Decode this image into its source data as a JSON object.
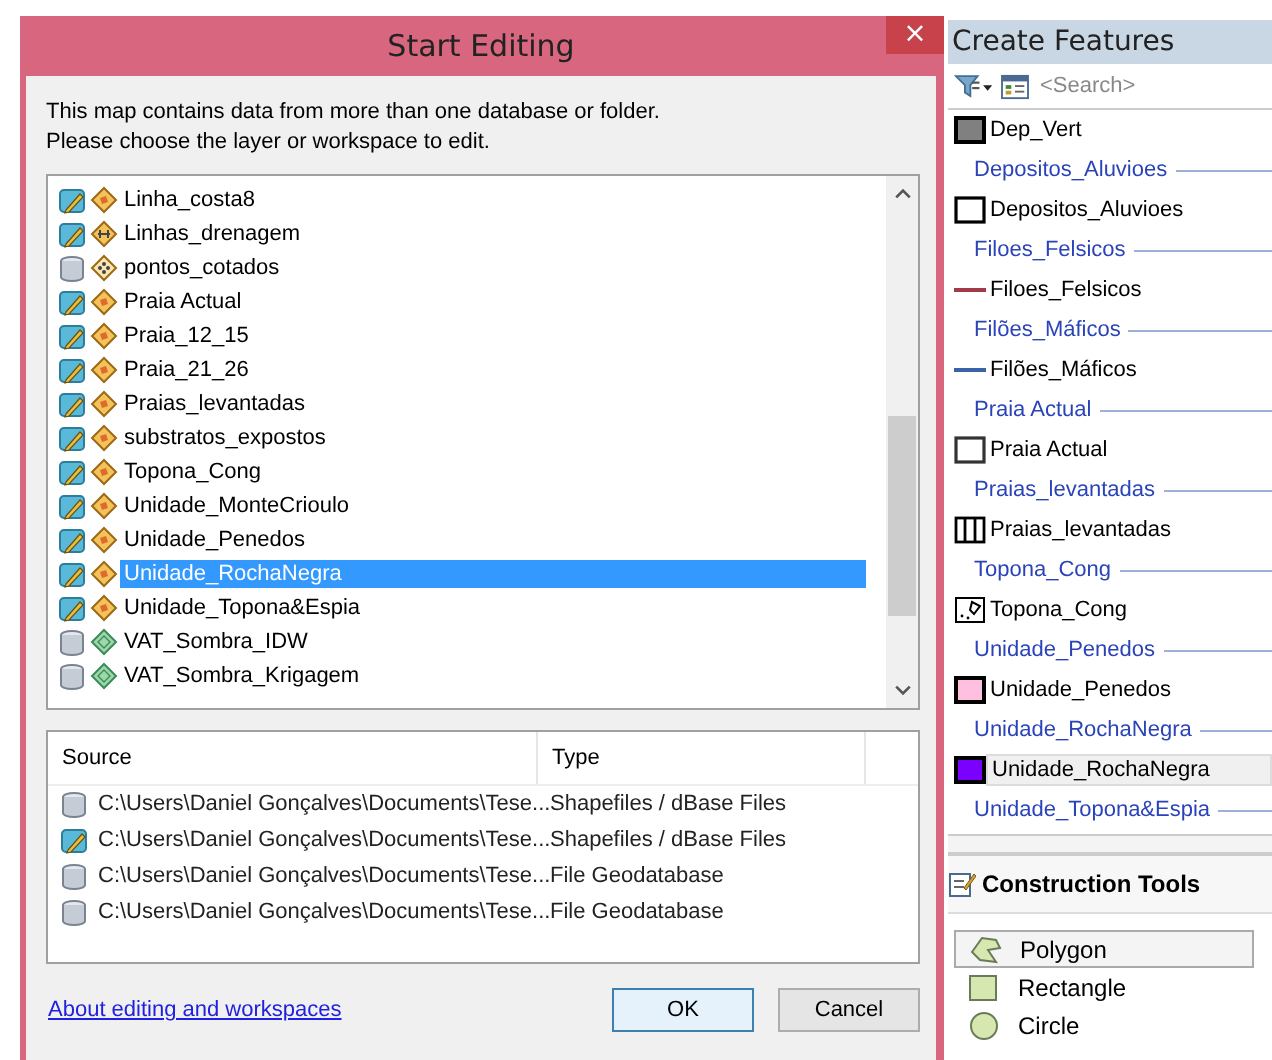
{
  "dialog": {
    "title": "Start Editing",
    "close": "×",
    "message": [
      "This map contains data from more than one database or folder.",
      "Please choose the layer or workspace to edit."
    ],
    "layers": [
      {
        "name": "Linha_costa8",
        "editable": true,
        "kind": "polygon",
        "selected": false
      },
      {
        "name": "Linhas_drenagem",
        "editable": true,
        "kind": "line",
        "selected": false
      },
      {
        "name": "pontos_cotados",
        "editable": false,
        "kind": "point",
        "selected": false
      },
      {
        "name": "Praia Actual",
        "editable": true,
        "kind": "polygon",
        "selected": false
      },
      {
        "name": "Praia_12_15",
        "editable": true,
        "kind": "polygon",
        "selected": false
      },
      {
        "name": "Praia_21_26",
        "editable": true,
        "kind": "polygon",
        "selected": false
      },
      {
        "name": "Praias_levantadas",
        "editable": true,
        "kind": "polygon",
        "selected": false
      },
      {
        "name": "substratos_expostos",
        "editable": true,
        "kind": "polygon",
        "selected": false
      },
      {
        "name": "Topona_Cong",
        "editable": true,
        "kind": "polygon",
        "selected": false
      },
      {
        "name": "Unidade_MonteCrioulo",
        "editable": true,
        "kind": "polygon",
        "selected": false
      },
      {
        "name": "Unidade_Penedos",
        "editable": true,
        "kind": "polygon",
        "selected": false
      },
      {
        "name": "Unidade_RochaNegra",
        "editable": true,
        "kind": "polygon",
        "selected": true
      },
      {
        "name": "Unidade_Topona&Espia",
        "editable": true,
        "kind": "polygon",
        "selected": false
      },
      {
        "name": "VAT_Sombra_IDW",
        "editable": false,
        "kind": "raster",
        "selected": false
      },
      {
        "name": "VAT_Sombra_Krigagem",
        "editable": false,
        "kind": "raster",
        "selected": false
      }
    ],
    "sources": {
      "columns": [
        "Source",
        "Type"
      ],
      "rows": [
        {
          "source": "C:\\Users\\Daniel Gonçalves\\Documents\\Tese...",
          "type": "Shapefiles / dBase Files",
          "editable": false
        },
        {
          "source": "C:\\Users\\Daniel Gonçalves\\Documents\\Tese...",
          "type": "Shapefiles / dBase Files",
          "editable": true
        },
        {
          "source": "C:\\Users\\Daniel Gonçalves\\Documents\\Tese...",
          "type": "File Geodatabase",
          "editable": false
        },
        {
          "source": "C:\\Users\\Daniel Gonçalves\\Documents\\Tese...",
          "type": "File Geodatabase",
          "editable": false
        }
      ]
    },
    "link": "About editing and workspaces",
    "buttons": [
      {
        "label": "OK",
        "default": true
      },
      {
        "label": "Cancel",
        "default": false
      }
    ]
  },
  "panel": {
    "title": "Create Features",
    "search": {
      "placeholder": "<Search>"
    },
    "templates": [
      {
        "kind": "fill",
        "name": "Dep_Vert",
        "color": "#808080",
        "selected": false
      },
      {
        "kind": "group",
        "name": "Depositos_Aluvioes"
      },
      {
        "kind": "outline",
        "name": "Depositos_Aluvioes",
        "color": "#000000",
        "selected": false
      },
      {
        "kind": "group",
        "name": "Filoes_Felsicos"
      },
      {
        "kind": "line",
        "name": "Filoes_Felsicos",
        "color": "#a33a4a",
        "selected": false
      },
      {
        "kind": "group",
        "name": "Filões_Máficos"
      },
      {
        "kind": "line",
        "name": "Filões_Máficos",
        "color": "#3a62a8",
        "selected": false
      },
      {
        "kind": "group",
        "name": "Praia Actual"
      },
      {
        "kind": "outline",
        "name": "Praia Actual",
        "color": "#333333",
        "selected": false
      },
      {
        "kind": "group",
        "name": "Praias_levantadas"
      },
      {
        "kind": "hatch",
        "name": "Praias_levantadas",
        "color": "#000000",
        "selected": false
      },
      {
        "kind": "group",
        "name": "Topona_Cong"
      },
      {
        "kind": "marker",
        "name": "Topona_Cong",
        "color": "#000000",
        "selected": false
      },
      {
        "kind": "group",
        "name": "Unidade_Penedos"
      },
      {
        "kind": "fill",
        "name": "Unidade_Penedos",
        "color": "#ffc0e0",
        "selected": false
      },
      {
        "kind": "group",
        "name": "Unidade_RochaNegra"
      },
      {
        "kind": "fill",
        "name": "Unidade_RochaNegra",
        "color": "#7a00ff",
        "selected": true
      },
      {
        "kind": "group",
        "name": "Unidade_Topona&Espia"
      }
    ],
    "tools_title": "Construction Tools",
    "tools": [
      {
        "label": "Polygon",
        "kind": "polygon",
        "selected": true
      },
      {
        "label": "Rectangle",
        "kind": "rectangle",
        "selected": false
      },
      {
        "label": "Circle",
        "kind": "circle",
        "selected": false
      }
    ]
  }
}
